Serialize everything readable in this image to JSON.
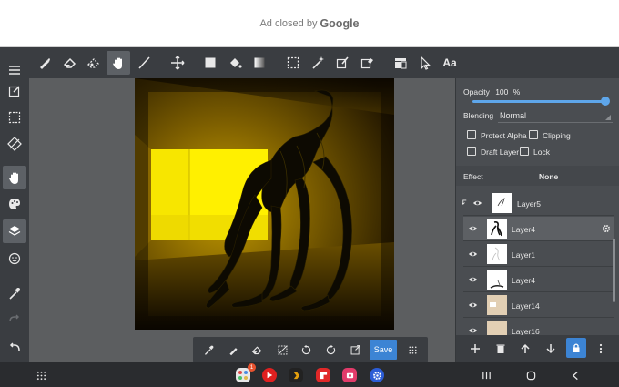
{
  "ad": {
    "text": "Ad closed by",
    "brand": "Google"
  },
  "toolbar": {
    "icons": [
      "brush-icon",
      "eraser-icon",
      "blur-icon",
      "hand-icon",
      "line-icon",
      "move-icon",
      "rect-fill-icon",
      "bucket-icon",
      "gradient-icon",
      "select-icon",
      "magic-wand-icon",
      "select-pen-icon",
      "select-eraser-icon",
      "layout-icon",
      "pointer-icon",
      "text-icon"
    ],
    "text_tool_label": "Aa",
    "active": "hand-icon"
  },
  "left_toolbar": {
    "icons": [
      "menu-icon",
      "edit-icon",
      "select-rect-icon",
      "transform-icon",
      "hand-icon",
      "palette-icon",
      "layers-icon",
      "emoji-icon",
      "eyedropper-icon",
      "redo-icon",
      "undo-icon"
    ]
  },
  "canvas_toolbar": {
    "icons": [
      "eyedropper-icon",
      "pen-icon",
      "eraser-icon",
      "deselect-icon",
      "rotate-left-icon",
      "rotate-right-icon",
      "export-icon",
      "grid-icon"
    ],
    "save_label": "Save"
  },
  "panel": {
    "opacity_label": "Opacity",
    "opacity_value": "100",
    "opacity_unit": "%",
    "blending_label": "Blending",
    "blending_value": "Normal",
    "protect_alpha": "Protect Alpha",
    "clipping": "Clipping",
    "draft_layer": "Draft Layer",
    "lock": "Lock",
    "effect_label": "Effect",
    "effect_value": "None",
    "layers": [
      {
        "name": "Layer5",
        "selected": false,
        "clipped": true
      },
      {
        "name": "Layer4",
        "selected": true,
        "clipped": false
      },
      {
        "name": "Layer1",
        "selected": false,
        "clipped": false
      },
      {
        "name": "Layer4",
        "selected": false,
        "clipped": false
      },
      {
        "name": "Layer14",
        "selected": false,
        "clipped": false
      },
      {
        "name": "Layer16",
        "selected": false,
        "clipped": false
      }
    ]
  },
  "nav": {
    "badge_count": "1",
    "apps": [
      "apps-grid-icon",
      "youtube-icon",
      "plex-icon",
      "flipboard-icon",
      "screen-recorder-icon",
      "settings-icon"
    ],
    "buttons": [
      "recents-icon",
      "home-icon",
      "back-icon"
    ]
  },
  "colors": {
    "accent": "#3c84d4",
    "slider": "#5ea6ea",
    "toolbar": "#3a3d41",
    "panel": "#4a4d51",
    "glow": "#fff200"
  }
}
